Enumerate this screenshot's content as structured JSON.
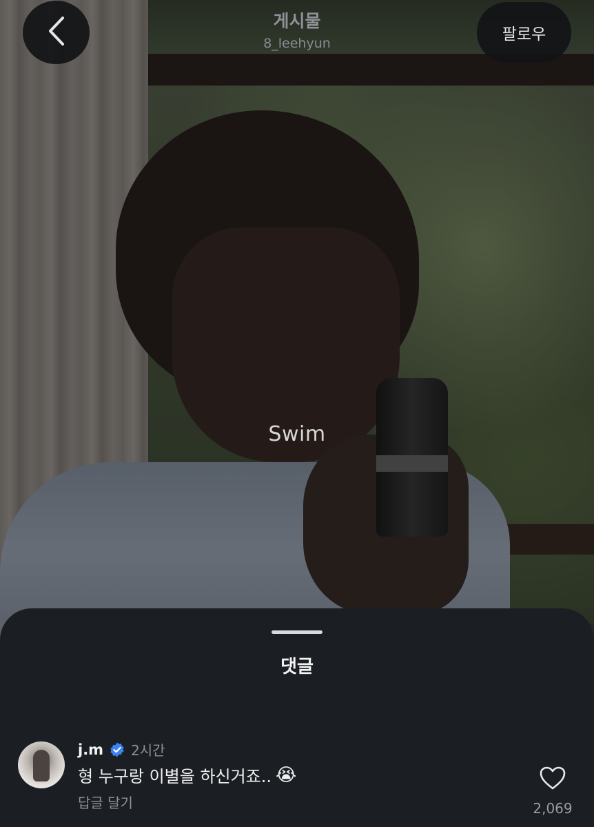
{
  "header": {
    "title": "게시물",
    "username": "8_leehyun",
    "follow_label": "팔로우"
  },
  "media": {
    "caption": "Swim"
  },
  "comments_sheet": {
    "title": "댓글",
    "comments": [
      {
        "username": "j.m",
        "verified": true,
        "timestamp": "2시간",
        "text": "형 누구랑 이별을 하신거죠..",
        "emoji": "😭",
        "reply_label": "답글 달기",
        "like_count": "2,069"
      }
    ]
  },
  "colors": {
    "sheet_background": "#1b1f24",
    "verified_badge": "#3b82f6",
    "button_background": "#121416"
  },
  "icons": {
    "back": "chevron-left-icon",
    "verified": "verified-badge-icon",
    "like": "heart-outline-icon"
  }
}
